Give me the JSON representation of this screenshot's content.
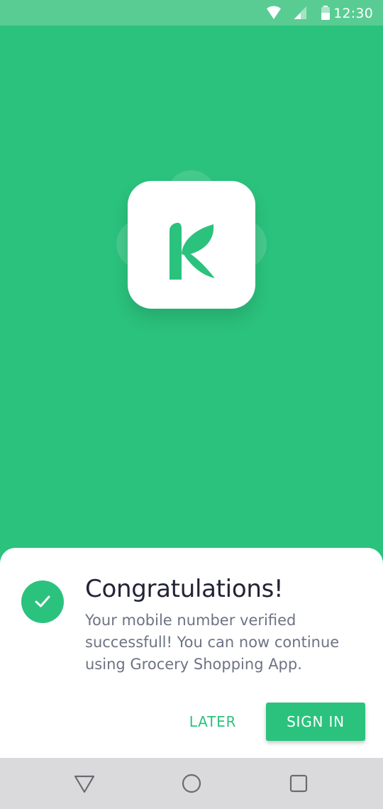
{
  "status_bar": {
    "time": "12:30",
    "icons": [
      "wifi-icon",
      "signal-icon",
      "battery-icon"
    ]
  },
  "hero": {
    "logo_icon": "leaf-k-logo-icon"
  },
  "dialog": {
    "icon": "check-icon",
    "title": "Congratulations!",
    "message": "Your mobile number verified successfull! You can now continue using Grocery Shopping App.",
    "later_label": "LATER",
    "signin_label": "SIGN IN"
  },
  "nav_bar": {
    "icons": [
      "back-triangle-icon",
      "home-circle-icon",
      "recents-square-icon"
    ]
  },
  "colors": {
    "brand_green": "#2BC27D",
    "status_bar": "#59CC93",
    "title_text": "#232336",
    "body_text": "#6E7383",
    "nav_bar": "#DADADC"
  }
}
